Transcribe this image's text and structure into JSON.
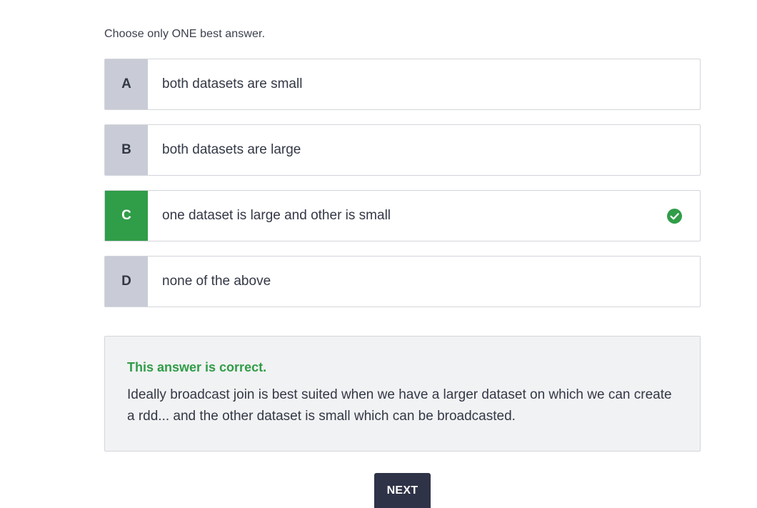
{
  "instruction": "Choose only ONE best answer.",
  "options": [
    {
      "letter": "A",
      "text": "both datasets are small",
      "state": "default"
    },
    {
      "letter": "B",
      "text": "both datasets are large",
      "state": "default"
    },
    {
      "letter": "C",
      "text": "one dataset is large and other is small",
      "state": "correct",
      "icon": "check-circle-icon"
    },
    {
      "letter": "D",
      "text": "none of the above",
      "state": "default"
    }
  ],
  "feedback": {
    "status": "This answer is correct.",
    "explanation": "Ideally broadcast join is best suited when we have a larger dataset on which we can create a rdd... and the other dataset is small which can be broadcasted."
  },
  "next_button": {
    "label": "NEXT"
  },
  "colors": {
    "correct": "#309d48",
    "letter_bg": "#c9ccd6",
    "button_bg": "#2f3347",
    "feedback_bg": "#f1f2f3"
  }
}
